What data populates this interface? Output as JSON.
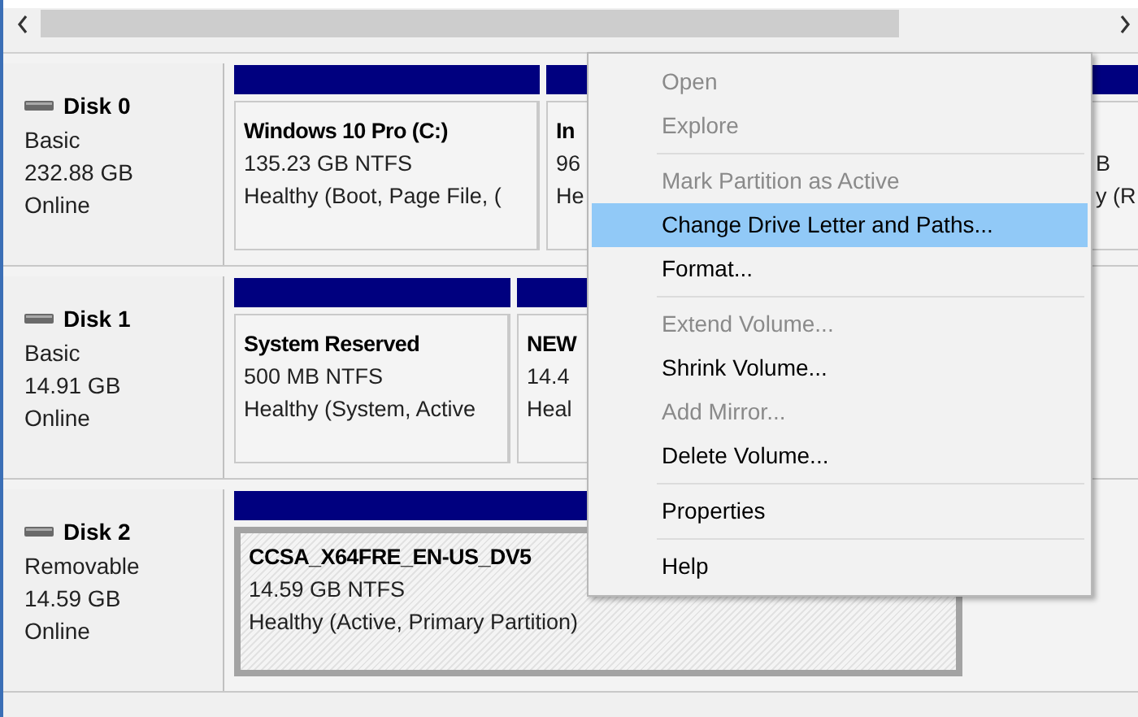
{
  "disks": [
    {
      "name": "Disk 0",
      "type": "Basic",
      "size": "232.88 GB",
      "status": "Online",
      "partitions": [
        {
          "name": "Windows 10 Pro  (C:)",
          "size": "135.23 GB NTFS",
          "status": "Healthy (Boot, Page File, (",
          "selected": false
        },
        {
          "name": "In",
          "size": "96",
          "status": "He",
          "selected": false
        },
        {
          "size": "B",
          "status": "y (R",
          "selected": false
        }
      ]
    },
    {
      "name": "Disk 1",
      "type": "Basic",
      "size": "14.91 GB",
      "status": "Online",
      "partitions": [
        {
          "name": "System Reserved",
          "size": "500 MB NTFS",
          "status": "Healthy (System, Active",
          "selected": false
        },
        {
          "name": "NEW",
          "size": "14.4",
          "status": "Heal",
          "selected": false
        }
      ]
    },
    {
      "name": "Disk 2",
      "type": "Removable",
      "size": "14.59 GB",
      "status": "Online",
      "partitions": [
        {
          "name": "CCSA_X64FRE_EN-US_DV5",
          "size": "14.59 GB NTFS",
          "status": "Healthy (Active, Primary Partition)",
          "selected": true
        }
      ]
    }
  ],
  "context_menu": {
    "groups": [
      [
        {
          "label": "Open",
          "disabled": true,
          "selected": false
        },
        {
          "label": "Explore",
          "disabled": true,
          "selected": false
        }
      ],
      [
        {
          "label": "Mark Partition as Active",
          "disabled": true,
          "selected": false
        },
        {
          "label": "Change Drive Letter and Paths...",
          "disabled": false,
          "selected": true
        },
        {
          "label": "Format...",
          "disabled": false,
          "selected": false
        }
      ],
      [
        {
          "label": "Extend Volume...",
          "disabled": true,
          "selected": false
        },
        {
          "label": "Shrink Volume...",
          "disabled": false,
          "selected": false
        },
        {
          "label": "Add Mirror...",
          "disabled": true,
          "selected": false
        },
        {
          "label": "Delete Volume...",
          "disabled": false,
          "selected": false
        }
      ],
      [
        {
          "label": "Properties",
          "disabled": false,
          "selected": false
        }
      ],
      [
        {
          "label": "Help",
          "disabled": false,
          "selected": false
        }
      ]
    ]
  }
}
